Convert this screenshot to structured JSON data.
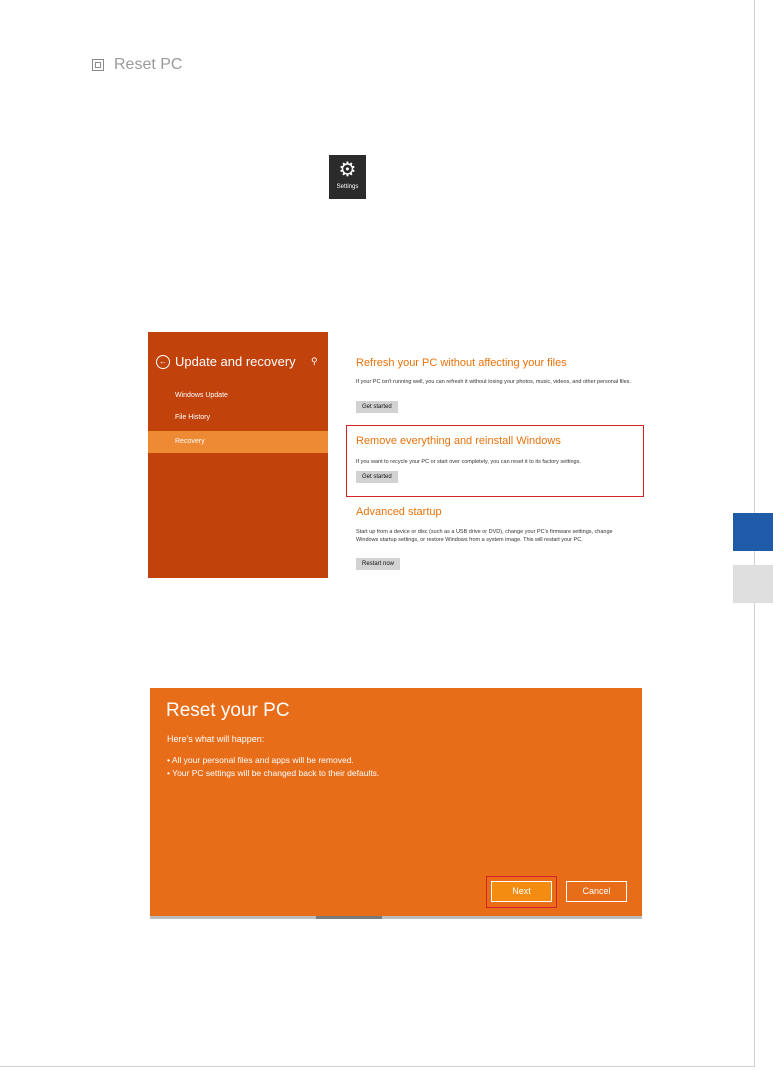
{
  "heading": {
    "title": "Reset PC"
  },
  "settings_tile": {
    "label": "Settings"
  },
  "update_recovery": {
    "title": "Update and recovery",
    "nav": [
      {
        "label": "Windows Update",
        "active": false
      },
      {
        "label": "File History",
        "active": false
      },
      {
        "label": "Recovery",
        "active": true
      }
    ],
    "sections": [
      {
        "title": "Refresh your PC without affecting your files",
        "desc": "If your PC isn't running well, you can refresh it without losing your photos, music, videos, and other personal files.",
        "button": "Get started"
      },
      {
        "title": "Remove everything and reinstall Windows",
        "desc": "If you want to recycle your PC or start over completely, you can reset it to its factory settings.",
        "button": "Get started"
      },
      {
        "title": "Advanced startup",
        "desc": "Start up from a device or disc (such as a USB drive or DVD), change your PC's firmware settings, change Windows startup settings, or restore Windows from a system image. This will restart your PC.",
        "button": "Restart now"
      }
    ]
  },
  "reset_dialog": {
    "title": "Reset your PC",
    "subtitle": "Here's what will happen:",
    "items": [
      "• All your personal files and apps will be removed.",
      "• Your PC settings will be changed back to their defaults."
    ],
    "next": "Next",
    "cancel": "Cancel"
  },
  "colors": {
    "accent_orange": "#e86d19",
    "sidebar_orange": "#c1420b",
    "highlight_red": "#d6232a",
    "tab_blue": "#1f5ba8"
  }
}
